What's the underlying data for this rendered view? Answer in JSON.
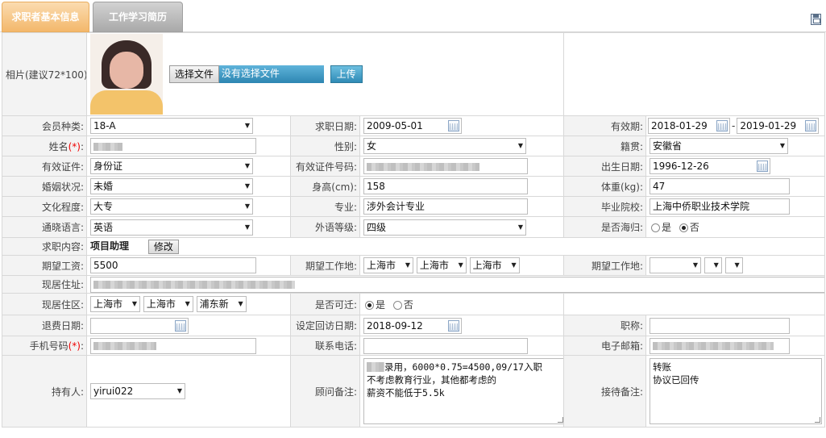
{
  "tabs": [
    "求职者基本信息",
    "工作学习简历"
  ],
  "photo": {
    "label": "相片(建议72*100):",
    "choose_file": "选择文件",
    "no_file": "没有选择文件",
    "upload": "上传"
  },
  "fields": {
    "member_type": {
      "label": "会员种类:",
      "value": "18-A"
    },
    "job_date": {
      "label": "求职日期:",
      "value": "2009-05-01"
    },
    "valid_period": {
      "label": "有效期:",
      "start": "2018-01-29",
      "sep": "-",
      "end": "2019-01-29"
    },
    "name": {
      "label": "姓名",
      "req": "(*)",
      "colon": ":"
    },
    "gender": {
      "label": "性别:",
      "value": "女"
    },
    "native_place": {
      "label": "籍贯:",
      "value": "安徽省"
    },
    "id_type": {
      "label": "有效证件:",
      "value": "身份证"
    },
    "id_number": {
      "label": "有效证件号码:"
    },
    "birth_date": {
      "label": "出生日期:",
      "value": "1996-12-26"
    },
    "marital": {
      "label": "婚姻状况:",
      "value": "未婚"
    },
    "height": {
      "label": "身高(cm):",
      "value": "158"
    },
    "weight": {
      "label": "体重(kg):",
      "value": "47"
    },
    "education": {
      "label": "文化程度:",
      "value": "大专"
    },
    "major": {
      "label": "专业:",
      "value": "涉外会计专业"
    },
    "school": {
      "label": "毕业院校:",
      "value": "上海中侨职业技术学院"
    },
    "language": {
      "label": "通晓语言:",
      "value": "英语"
    },
    "foreign_level": {
      "label": "外语等级:",
      "value": "四级"
    },
    "returnee": {
      "label": "是否海归:",
      "yes": "是",
      "no": "否"
    },
    "job_content": {
      "label": "求职内容:",
      "value": "项目助理",
      "edit": "修改"
    },
    "expected_salary": {
      "label": "期望工资:",
      "value": "5500"
    },
    "expected_place": {
      "label": "期望工作地:",
      "a": "上海市",
      "b": "上海市",
      "c": "上海市"
    },
    "expected_place2": {
      "label": "期望工作地:"
    },
    "address": {
      "label": "现居住址:"
    },
    "living_area": {
      "label": "现居住区:",
      "a": "上海市",
      "b": "上海市",
      "c": "浦东新"
    },
    "relocate": {
      "label": "是否可迁:",
      "yes": "是",
      "no": "否"
    },
    "refund_date": {
      "label": "退费日期:"
    },
    "callback_date": {
      "label": "设定回访日期:",
      "value": "2018-09-12"
    },
    "title": {
      "label": "职称:"
    },
    "mobile": {
      "label": "手机号码",
      "req": "(*)",
      "colon": ":"
    },
    "phone": {
      "label": "联系电话:"
    },
    "email": {
      "label": "电子邮箱:"
    },
    "holder": {
      "label": "持有人:",
      "value": "yirui022"
    },
    "consultant_note": {
      "label": "顾问备注:",
      "value": "录用，6000*0.75=4500,09/17入职\n不考虑教育行业，其他都考虑的\n薪资不能低于5.5k"
    },
    "reception_note": {
      "label": "接待备注:",
      "value": "转账\n协议已回传"
    }
  }
}
